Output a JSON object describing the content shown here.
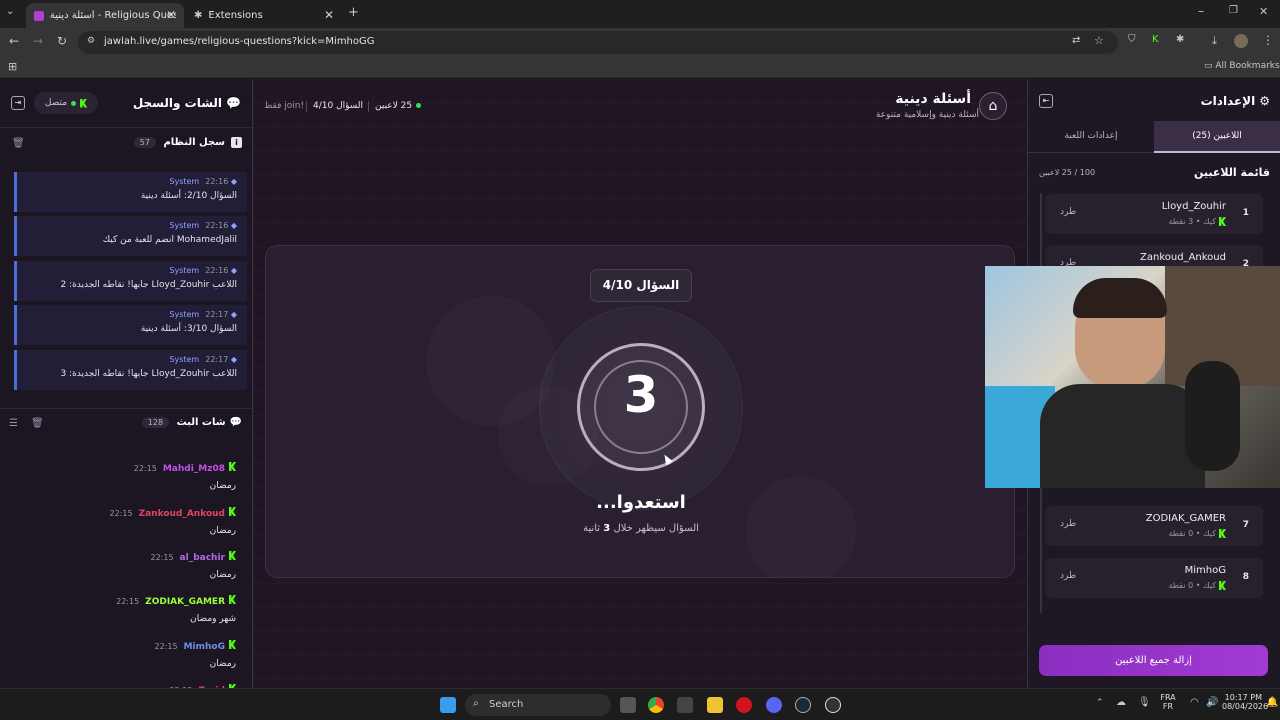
{
  "browser": {
    "tabs": [
      {
        "label": "أسئلة دينية - Religious Questions",
        "active": true
      },
      {
        "label": "Extensions",
        "active": false
      }
    ],
    "url": "jawlah.live/games/religious-questions?kick=MimhoGG",
    "bookmarks_label": "All Bookmarks"
  },
  "left": {
    "chat_title": "الشات والسجل",
    "status": "متصل",
    "system_log_title": "سجل النظام",
    "system_log_count": "57",
    "system_messages": [
      {
        "sender": "System",
        "time": "22:16",
        "text": "السؤال 2/10: أسئلة دينية"
      },
      {
        "sender": "System",
        "time": "22:16",
        "text": "MohamedJalil انضم للعبة من كيك"
      },
      {
        "sender": "System",
        "time": "22:16",
        "text": "اللاعب Lloyd_Zouhir جابها! نقاطه الجديدة: 2"
      },
      {
        "sender": "System",
        "time": "22:17",
        "text": "السؤال 3/10: أسئلة دينية"
      },
      {
        "sender": "System",
        "time": "22:17",
        "text": "اللاعب Lloyd_Zouhir جابها! نقاطه الجديدة: 3"
      }
    ],
    "stream_chat_title": "شات البث",
    "stream_chat_count": "128",
    "chat_messages": [
      {
        "name": "Mahdi_Mz08",
        "time": "22:15",
        "text": "رمضان",
        "color": "#c052e6"
      },
      {
        "name": "Zankoud_Ankoud",
        "time": "22:15",
        "text": "رمضان",
        "color": "#e0455e"
      },
      {
        "name": "al_bachir",
        "time": "22:15",
        "text": "رمضان",
        "color": "#b26be8"
      },
      {
        "name": "ZODIAK_GAMER",
        "time": "22:15",
        "text": "شهر ومضان",
        "color": "#9bff3a"
      },
      {
        "name": "MimhoG",
        "time": "22:15",
        "text": "رمضان",
        "color": "#6f8df0"
      },
      {
        "name": "Zarid",
        "time": "22:15",
        "text": "",
        "color": "#e0455e"
      }
    ]
  },
  "center": {
    "game_title": "أسئلة دينية",
    "game_subtitle": "أسئلة دينية وإسلامية متنوعة",
    "players_count": "25 لاعبين",
    "question_status": "السؤال 4/10",
    "join_hint": "!join فقط",
    "question_badge": "السؤال 4/10",
    "countdown": "3",
    "ready_text": "استعدوا...",
    "subtext_before": "السؤال سيظهر خلال",
    "subtext_num": "3",
    "subtext_after": "ثانية"
  },
  "right": {
    "settings_title": "الإعدادات",
    "tab_players": "اللاعبين (25)",
    "tab_game_settings": "إعدادات اللعبة",
    "players_list_title": "قائمة اللاعبين",
    "players_capacity": "100 / 25 لاعبين",
    "kick_label": "طرد",
    "players": [
      {
        "rank": "1",
        "name": "Lloyd_Zouhir",
        "platform": "كيك",
        "points": "3 نقطة"
      },
      {
        "rank": "2",
        "name": "Zankoud_Ankoud",
        "platform": "",
        "points": ""
      },
      {
        "rank": "7",
        "name": "ZODIAK_GAMER",
        "platform": "كيك",
        "points": "0 نقطة"
      },
      {
        "rank": "8",
        "name": "MimhoG",
        "platform": "كيك",
        "points": "0 نقطة"
      }
    ],
    "remove_all_label": "إزالة جميع اللاعبين"
  },
  "taskbar": {
    "search_label": "Search",
    "lang_top": "FRA",
    "lang_bottom": "FR",
    "time": "10:17 PM",
    "date": "08/04/2026"
  },
  "colors": {
    "accent_purple": "#9b35c9",
    "kick_green": "#53fc18",
    "online_green": "#3ddc5a"
  }
}
